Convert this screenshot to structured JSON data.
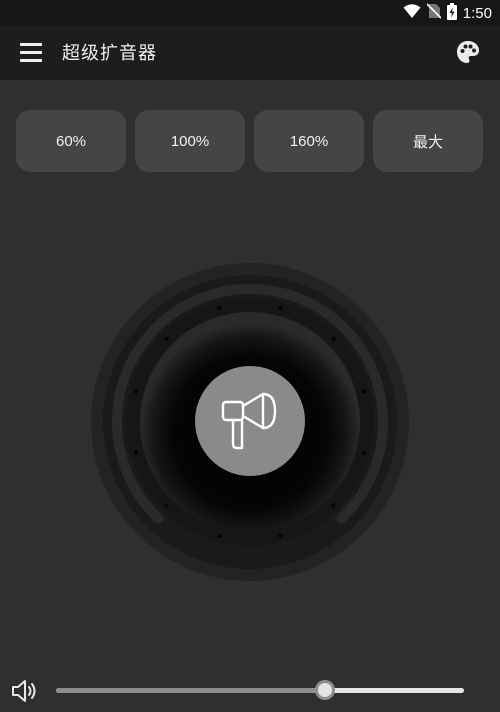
{
  "status_bar": {
    "time": "1:50"
  },
  "app_bar": {
    "title": "超级扩音器"
  },
  "presets": [
    {
      "label": "60%"
    },
    {
      "label": "100%"
    },
    {
      "label": "160%"
    },
    {
      "label": "最大"
    }
  ],
  "volume": {
    "level_percent": 66
  },
  "icons": {
    "menu": "hamburger-menu-icon",
    "palette": "palette-icon",
    "megaphone": "megaphone-icon",
    "volume": "speaker-volume-icon"
  },
  "colors": {
    "background": "#2e2f30",
    "appbar": "#1c1d1d",
    "preset_button": "#444545",
    "center_button": "#8a8a8a"
  }
}
